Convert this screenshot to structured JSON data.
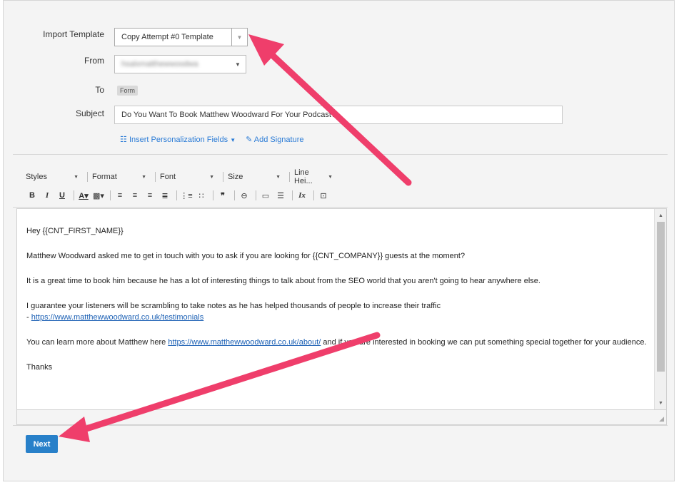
{
  "form": {
    "import_template_label": "Import Template",
    "import_template_value": "Copy Attempt #0 Template",
    "from_label": "From",
    "from_value": "hsalxmatthewwoodwa",
    "to_label": "To",
    "to_tag": "Form",
    "subject_label": "Subject",
    "subject_value": "Do You Want To Book Matthew Woodward For Your Podcast?",
    "insert_fields_link": "Insert Personalization Fields",
    "add_signature_link": "Add Signature"
  },
  "toolbar": {
    "combos": [
      "Styles",
      "Format",
      "Font",
      "Size",
      "Line Hei..."
    ],
    "icons": [
      {
        "name": "bold-icon",
        "glyph": "B",
        "cls": "b"
      },
      {
        "name": "italic-icon",
        "glyph": "I",
        "cls": "i"
      },
      {
        "name": "underline-icon",
        "glyph": "U",
        "cls": "u"
      },
      {
        "name": "sep"
      },
      {
        "name": "text-color-icon",
        "glyph": "A▾",
        "cls": "u"
      },
      {
        "name": "background-color-icon",
        "glyph": "▩▾",
        "cls": ""
      },
      {
        "name": "sep"
      },
      {
        "name": "align-left-icon",
        "glyph": "≡",
        "cls": ""
      },
      {
        "name": "align-center-icon",
        "glyph": "≡",
        "cls": ""
      },
      {
        "name": "align-right-icon",
        "glyph": "≡",
        "cls": ""
      },
      {
        "name": "align-justify-icon",
        "glyph": "≣",
        "cls": ""
      },
      {
        "name": "sep"
      },
      {
        "name": "numbered-list-icon",
        "glyph": "⋮≡",
        "cls": ""
      },
      {
        "name": "bulleted-list-icon",
        "glyph": "∷",
        "cls": ""
      },
      {
        "name": "sep"
      },
      {
        "name": "blockquote-icon",
        "glyph": "❞",
        "cls": "b"
      },
      {
        "name": "sep"
      },
      {
        "name": "link-icon",
        "glyph": "⊖",
        "cls": ""
      },
      {
        "name": "sep"
      },
      {
        "name": "image-icon",
        "glyph": "▭",
        "cls": ""
      },
      {
        "name": "horizontal-rule-icon",
        "glyph": "☰",
        "cls": ""
      },
      {
        "name": "sep"
      },
      {
        "name": "clear-format-icon",
        "glyph": "Ix",
        "cls": "i"
      },
      {
        "name": "sep"
      },
      {
        "name": "source-code-icon",
        "glyph": "⊡",
        "cls": ""
      }
    ]
  },
  "body": {
    "greeting": "Hey {{CNT_FIRST_NAME}}",
    "p1": "Matthew Woodward asked me to get in touch with you to ask if you are looking for {{CNT_COMPANY}} guests at the moment?",
    "p2": "It is a great time to book him because he has a lot of interesting things to talk about from the SEO world that you aren't going to hear anywhere else.",
    "p3_line1": "I guarantee your listeners will be scrambling to take notes as he has helped thousands of people to increase their traffic",
    "p3_dash": "- ",
    "p3_link": "https://www.matthewwoodward.co.uk/testimonials",
    "p4_text1": "You can learn more about Matthew here ",
    "p4_link": "https://www.matthewwoodward.co.uk/about/",
    "p4_text2": " and if you are interested in booking we can put something special together for your audience.",
    "closing": "Thanks"
  },
  "next_button": "Next",
  "colors": {
    "accent": "#2880c9",
    "link": "#2a7bd6",
    "arrow": "#ef3e6b"
  }
}
